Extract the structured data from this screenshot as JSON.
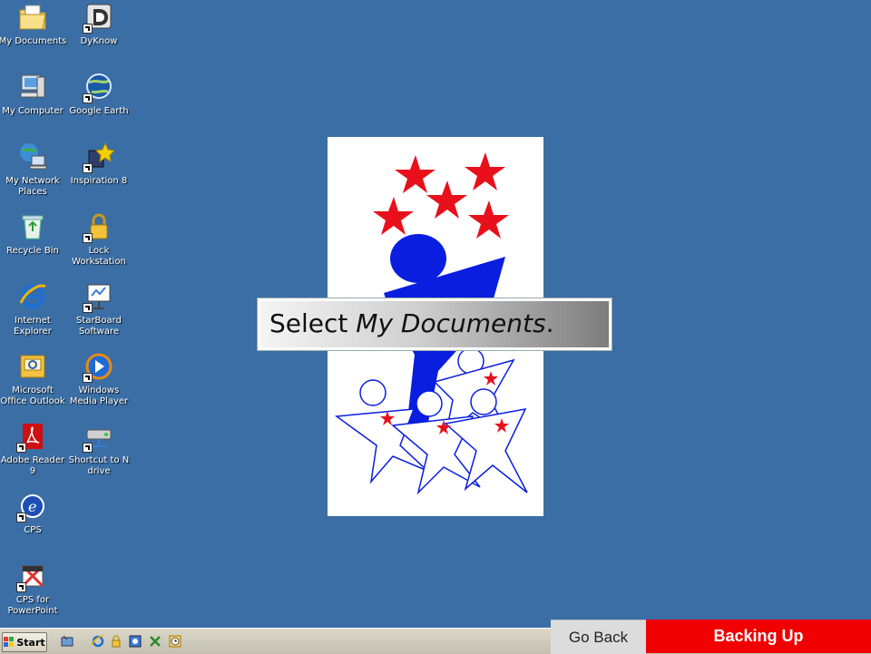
{
  "desktop": {
    "icons": [
      {
        "label": "My Documents",
        "icon": "folder-documents-icon"
      },
      {
        "label": "DyKnow",
        "icon": "dyknow-icon"
      },
      {
        "label": "My Computer",
        "icon": "computer-icon"
      },
      {
        "label": "Google Earth",
        "icon": "globe-icon"
      },
      {
        "label": "My Network Places",
        "icon": "network-icon"
      },
      {
        "label": "Inspiration 8",
        "icon": "inspiration-icon"
      },
      {
        "label": "Recycle Bin",
        "icon": "recycle-bin-icon"
      },
      {
        "label": "Lock Workstation",
        "icon": "lock-icon"
      },
      {
        "label": "Internet Explorer",
        "icon": "internet-explorer-icon"
      },
      {
        "label": "StarBoard Software",
        "icon": "starboard-icon"
      },
      {
        "label": "Microsoft Office Outlook",
        "icon": "outlook-icon"
      },
      {
        "label": "Windows Media Player",
        "icon": "media-player-icon"
      },
      {
        "label": "Adobe Reader 9",
        "icon": "pdf-icon"
      },
      {
        "label": "Shortcut to N drive",
        "icon": "network-drive-icon"
      },
      {
        "label": "CPS",
        "icon": "cps-icon"
      },
      {
        "label": "CPS for PowerPoint",
        "icon": "cps-powerpoint-icon"
      }
    ]
  },
  "callout": {
    "prefix": "Select ",
    "target": "My Documents",
    "suffix": "."
  },
  "taskbar": {
    "start_label": "Start"
  },
  "nav": {
    "go_back": "Go Back",
    "section_title": "Backing Up"
  },
  "colors": {
    "desktop": "#3a6ea5",
    "banner_red": "#f00000",
    "logo_blue": "#0a1ee0",
    "logo_red": "#e8101a"
  }
}
